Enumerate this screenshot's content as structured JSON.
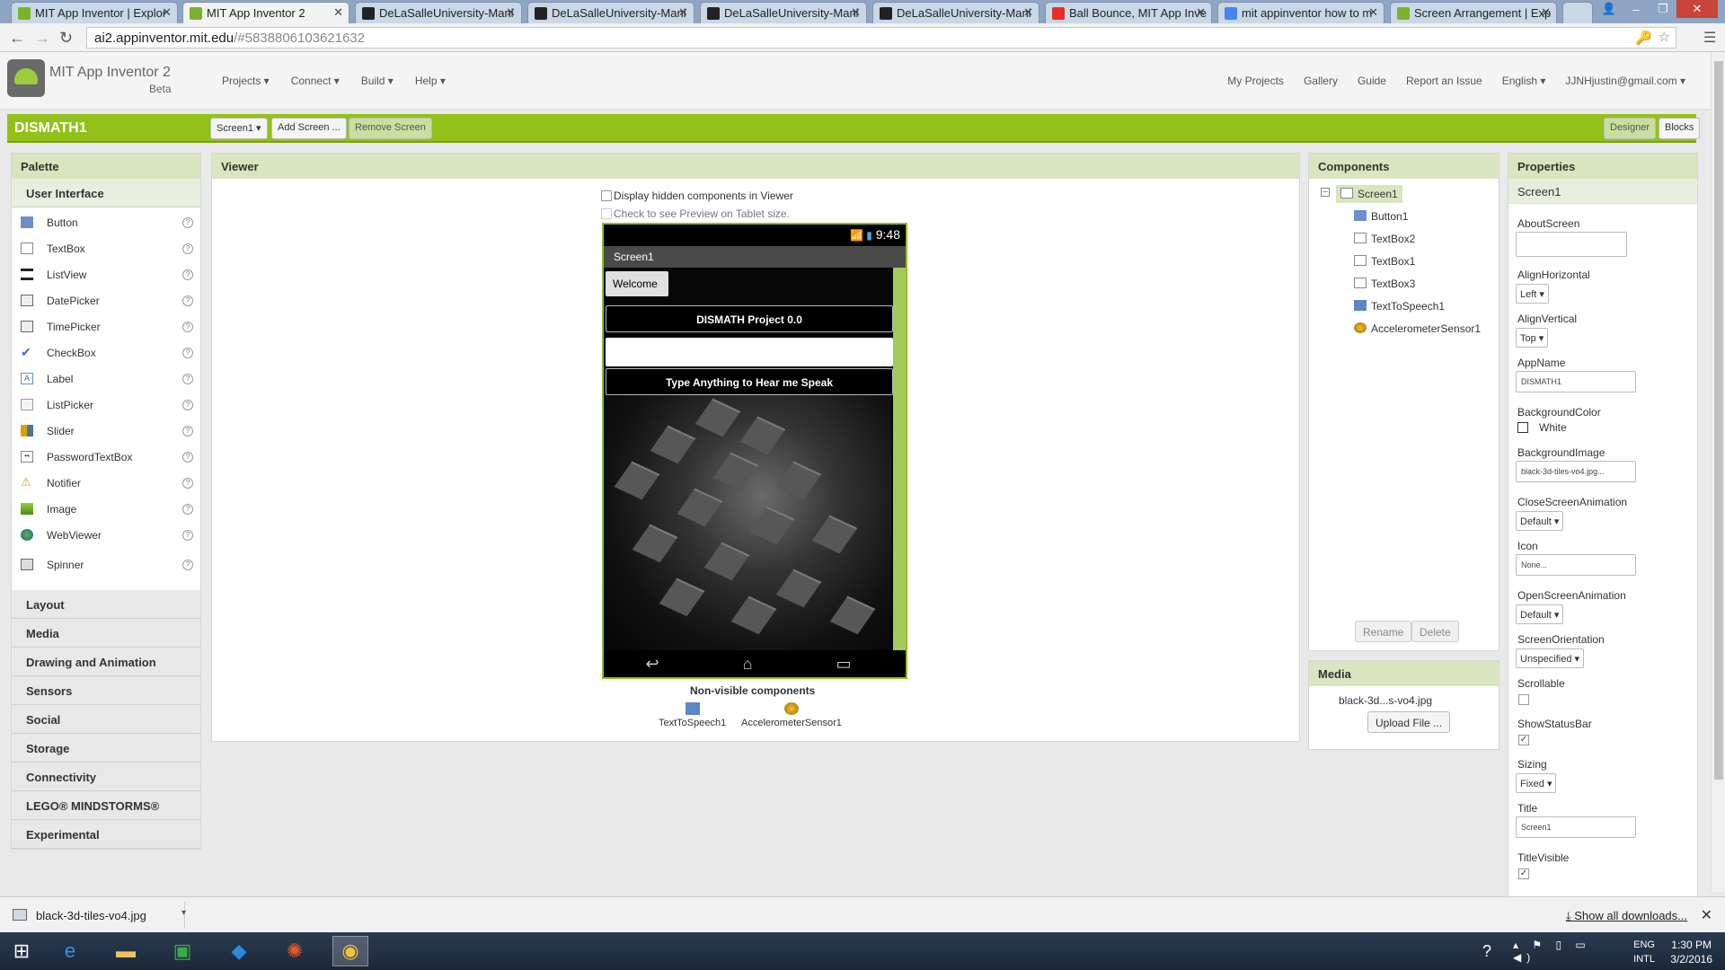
{
  "browser": {
    "tabs": [
      {
        "title": "MIT App Inventor | Explor",
        "fav": "#7ab32a"
      },
      {
        "title": "MIT App Inventor 2",
        "fav": "#7ab32a"
      },
      {
        "title": "DeLaSalleUniversity-Mani",
        "fav": "#222222"
      },
      {
        "title": "DeLaSalleUniversity-Mani",
        "fav": "#222222"
      },
      {
        "title": "DeLaSalleUniversity-Mani",
        "fav": "#222222"
      },
      {
        "title": "DeLaSalleUniversity-Mani",
        "fav": "#222222"
      },
      {
        "title": "Ball Bounce, MIT App Inve",
        "fav": "#e52d27"
      },
      {
        "title": "mit appinventor how to m",
        "fav": "#4285f4"
      },
      {
        "title": "Screen Arrangement | Exp",
        "fav": "#7ab32a"
      }
    ],
    "url_host": "ai2.appinventor.mit.edu",
    "url_path": "/#5838806103621632"
  },
  "header": {
    "brand": "MIT App Inventor 2",
    "beta": "Beta",
    "menu": [
      "Projects ▾",
      "Connect ▾",
      "Build ▾",
      "Help ▾"
    ],
    "links": [
      "My Projects",
      "Gallery",
      "Guide",
      "Report an Issue",
      "English ▾",
      "JJNHjustin@gmail.com ▾"
    ]
  },
  "project": {
    "name": "DISMATH1",
    "screen_select": "Screen1 ▾",
    "add_screen": "Add Screen ...",
    "remove_screen": "Remove Screen",
    "designer": "Designer",
    "blocks": "Blocks"
  },
  "palette": {
    "title": "Palette",
    "open_group": "User Interface",
    "items": [
      "Button",
      "TextBox",
      "ListView",
      "DatePicker",
      "TimePicker",
      "CheckBox",
      "Label",
      "ListPicker",
      "Slider",
      "PasswordTextBox",
      "Notifier",
      "Image",
      "WebViewer",
      "Spinner"
    ],
    "groups": [
      "Layout",
      "Media",
      "Drawing and Animation",
      "Sensors",
      "Social",
      "Storage",
      "Connectivity",
      "LEGO® MINDSTORMS®",
      "Experimental"
    ],
    "help": "?"
  },
  "viewer": {
    "title": "Viewer",
    "hidden_check": "Display hidden components in Viewer",
    "tablet_check": "Check to see Preview on Tablet size.",
    "time": "9:48",
    "screen_title": "Screen1",
    "welcome_button": "Welcome",
    "label1": "DISMATH Project 0.0",
    "label2": "Type Anything to Hear me Speak",
    "nonvisible_title": "Non-visible components",
    "nonvisible": [
      "TextToSpeech1",
      "AccelerometerSensor1"
    ]
  },
  "components": {
    "title": "Components",
    "root": "Screen1",
    "children": [
      "Button1",
      "TextBox2",
      "TextBox1",
      "TextBox3",
      "TextToSpeech1",
      "AccelerometerSensor1"
    ],
    "rename": "Rename",
    "delete": "Delete"
  },
  "media": {
    "title": "Media",
    "file": "black-3d...s-vo4.jpg",
    "upload": "Upload File ..."
  },
  "properties": {
    "title": "Properties",
    "component": "Screen1",
    "about_screen": "AboutScreen",
    "align_h": "AlignHorizontal",
    "align_h_val": "Left ▾",
    "align_v": "AlignVertical",
    "align_v_val": "Top ▾",
    "app_name": "AppName",
    "app_name_val": "DISMATH1",
    "bg_color": "BackgroundColor",
    "bg_color_val": "White",
    "bg_image": "BackgroundImage",
    "bg_image_val": "black-3d-tiles-vo4.jpg...",
    "close_anim": "CloseScreenAnimation",
    "close_anim_val": "Default ▾",
    "icon": "Icon",
    "icon_val": "None...",
    "open_anim": "OpenScreenAnimation",
    "open_anim_val": "Default ▾",
    "orientation": "ScreenOrientation",
    "orientation_val": "Unspecified ▾",
    "scrollable": "Scrollable",
    "show_status": "ShowStatusBar",
    "sizing": "Sizing",
    "sizing_val": "Fixed ▾",
    "title_prop": "Title",
    "title_val": "Screen1",
    "title_visible": "TitleVisible",
    "check": "✓"
  },
  "downloads": {
    "file": "black-3d-tiles-vo4.jpg",
    "show_all": "Show all downloads...",
    "close": "✕"
  },
  "taskbar": {
    "lang1": "ENG",
    "lang2": "INTL",
    "time": "1:30 PM",
    "date": "3/2/2016"
  },
  "colors": {
    "accent_green": "#92c11a",
    "panel_head": "#d9e5bf"
  }
}
